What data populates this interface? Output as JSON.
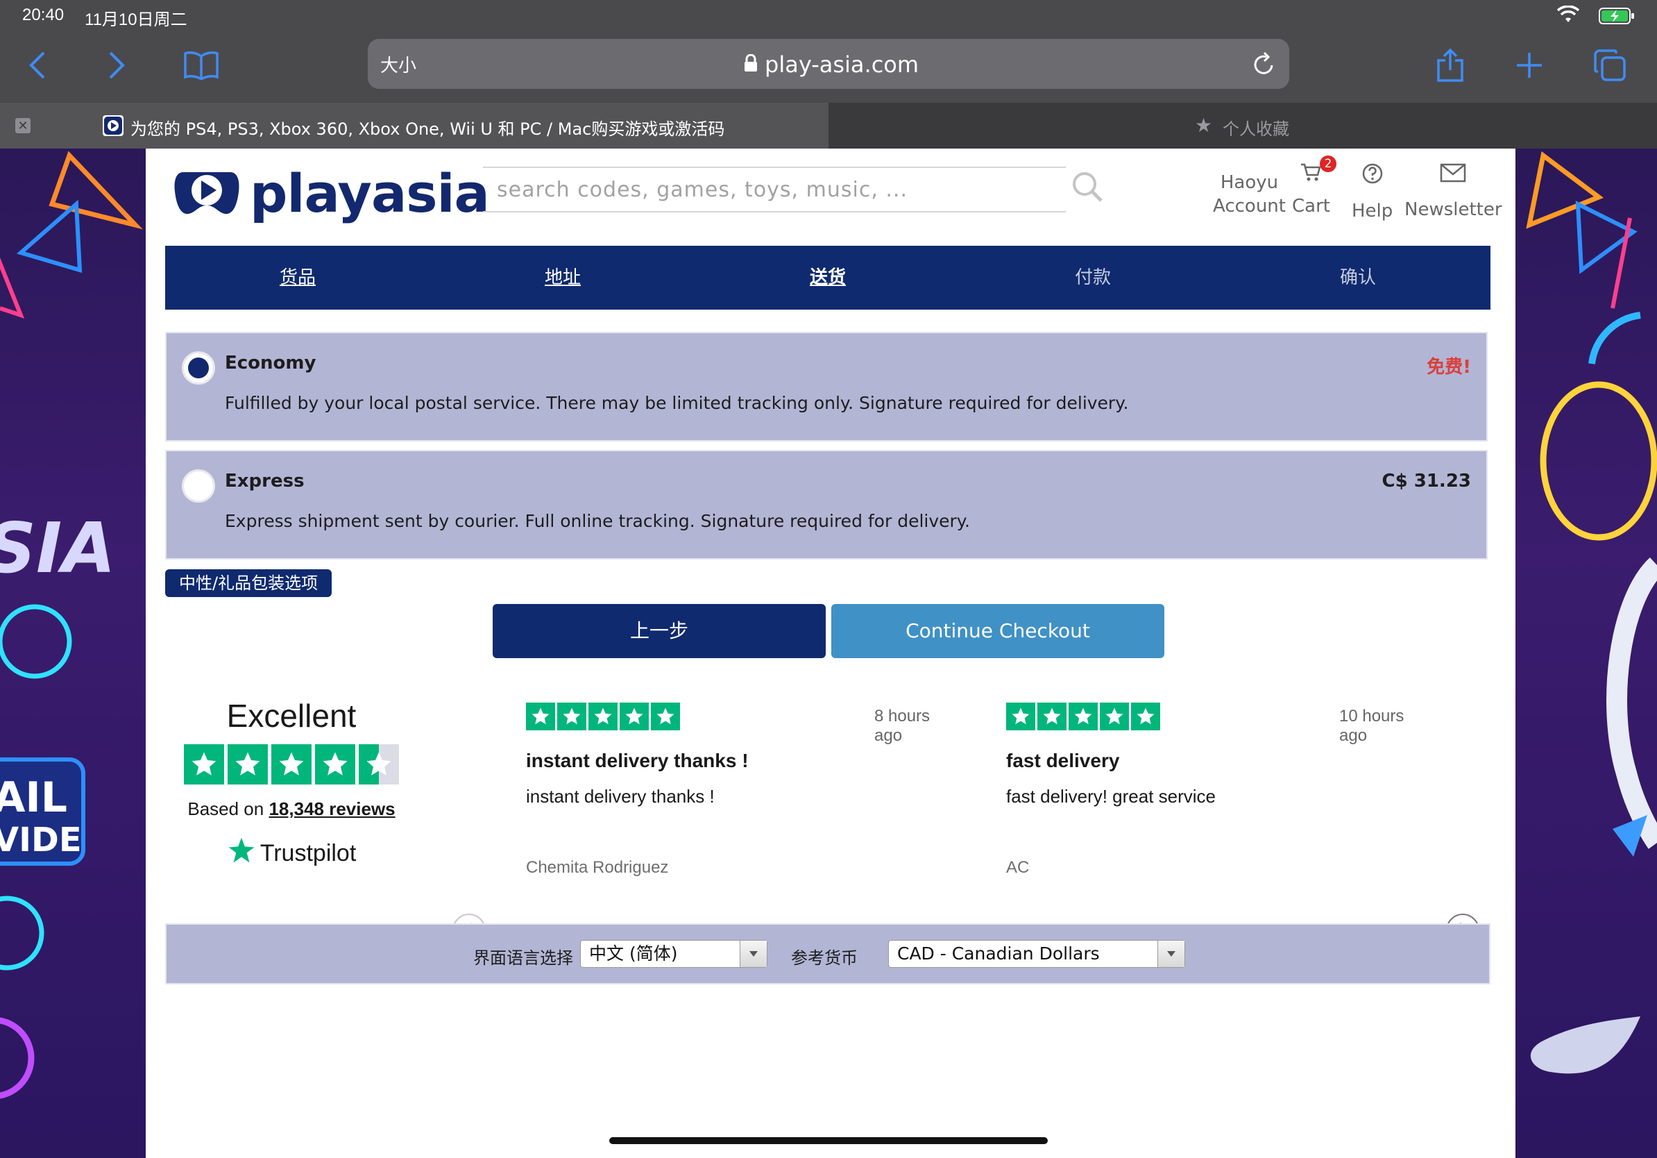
{
  "status_bar": {
    "time": "20:40",
    "date": "11月10日周二"
  },
  "browser": {
    "text_size_btn": "大小",
    "url": "play-asia.com",
    "active_tab_title": "为您的 PS4, PS3, Xbox 360, Xbox One, Wii U 和 PC / Mac购买游戏或激活码",
    "favorites_tab": "个人收藏"
  },
  "header": {
    "logo_text": "playasia",
    "search_placeholder": "search codes, games, toys, music, ...",
    "account_line1": "Haoyu",
    "account_line2": "Account",
    "cart_label": "Cart",
    "cart_count": "2",
    "help_label": "Help",
    "newsletter_label": "Newsletter"
  },
  "steps": [
    {
      "label": "货品"
    },
    {
      "label": "地址"
    },
    {
      "label": "送货"
    },
    {
      "label": "付款"
    },
    {
      "label": "确认"
    }
  ],
  "shipping": [
    {
      "name": "Economy",
      "desc": "Fulfilled by your local postal service. There may be limited tracking only. Signature required for delivery.",
      "price": "免费!",
      "selected": true
    },
    {
      "name": "Express",
      "desc": "Express shipment sent by courier. Full online tracking. Signature required for delivery.",
      "price": "C$ 31.23",
      "selected": false
    }
  ],
  "gift_option": "中性/礼品包装选项",
  "buttons": {
    "back": "上一步",
    "continue": "Continue Checkout"
  },
  "trustpilot": {
    "rating_word": "Excellent",
    "based_on": "Based on",
    "review_count": "18,348 reviews",
    "brand": "Trustpilot",
    "stars": 4.5,
    "reviews": [
      {
        "time_ago": "8 hours ago",
        "title": "instant delivery thanks !",
        "body": "instant delivery thanks !",
        "author": "Chemita Rodriguez",
        "stars": 5
      },
      {
        "time_ago": "10 hours ago",
        "title": "fast delivery",
        "body": "fast delivery! great service",
        "author": "AC",
        "stars": 5
      }
    ]
  },
  "footer": {
    "language_label": "界面语言选择",
    "language_value": "中文 (简体)",
    "currency_label": "参考货币",
    "currency_value": "CAD - Canadian Dollars"
  },
  "colors": {
    "brand_navy": "#0f2a6e",
    "continue_blue": "#4091c6",
    "option_bg": "#b3b5d5",
    "free_red": "#d9413a",
    "trustpilot_green": "#00b67a"
  }
}
